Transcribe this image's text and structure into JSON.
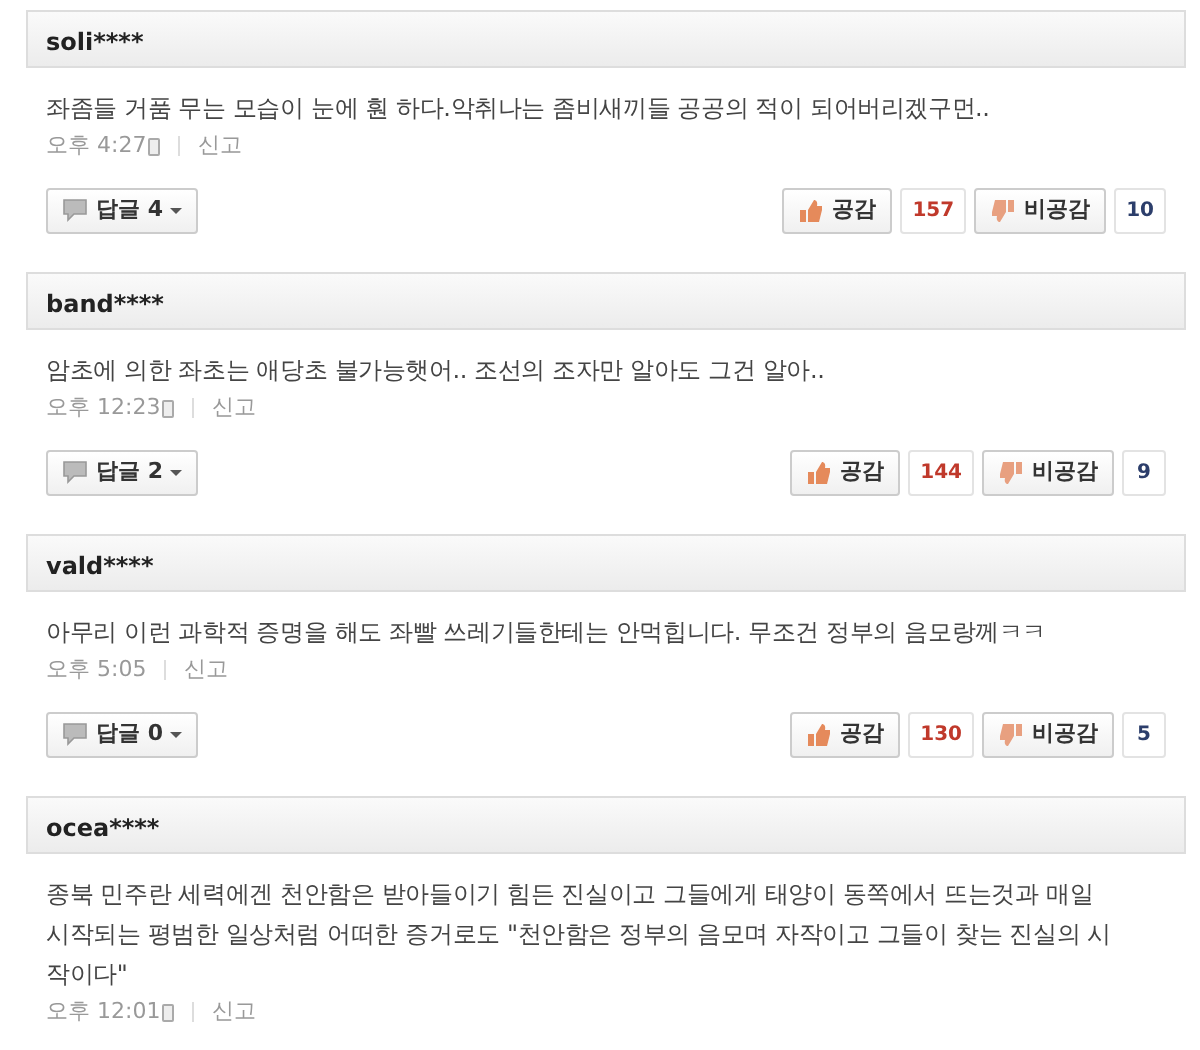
{
  "comments": [
    {
      "user": "soli****",
      "text": "좌좀들 거품 무는 모습이 눈에 훤 하다.악취나는 좀비새끼들 공공의 적이 되어버리겠구먼..",
      "time": "오후 4:27",
      "mobile": true,
      "report": "신고",
      "actions": {
        "reply_label": "답글",
        "reply_count": "4",
        "like_label": "공감",
        "like_count": "157",
        "dislike_label": "비공감",
        "dislike_count": "10"
      }
    },
    {
      "user": "band****",
      "text": "암초에 의한 좌초는 애당초 불가능햇어.. 조선의 조자만 알아도 그건 알아..",
      "time": "오후 12:23",
      "mobile": true,
      "report": "신고",
      "actions": {
        "reply_label": "답글",
        "reply_count": "2",
        "like_label": "공감",
        "like_count": "144",
        "dislike_label": "비공감",
        "dislike_count": "9"
      }
    },
    {
      "user": "vald****",
      "text": "아무리 이런 과학적 증명을 해도 좌빨 쓰레기들한테는 안먹힙니다. 무조건 정부의 음모랑께ㅋㅋ",
      "time": "오후 5:05",
      "mobile": false,
      "report": "신고",
      "actions": {
        "reply_label": "답글",
        "reply_count": "0",
        "like_label": "공감",
        "like_count": "130",
        "dislike_label": "비공감",
        "dislike_count": "5"
      }
    },
    {
      "user": "ocea****",
      "text": "종북 민주란 세력에겐 천안함은 받아들이기 힘든 진실이고 그들에게 태양이 동쪽에서 뜨는것과 매일 시작되는 평범한 일상처럼 어떠한 증거로도 \"천안함은 정부의 음모며 자작이고 그들이 찾는 진실의 시작이다\"",
      "time": "오후 12:01",
      "mobile": true,
      "report": "신고"
    }
  ]
}
